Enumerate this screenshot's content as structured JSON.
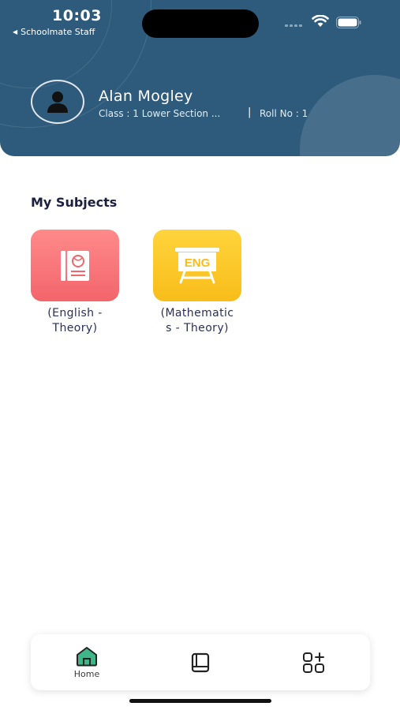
{
  "status_bar": {
    "time": "10:03",
    "back_app": "Schoolmate Staff"
  },
  "profile": {
    "name": "Alan Mogley",
    "class_info": "Class : 1 Lower Section ...",
    "separator": "|",
    "roll": "Roll No : 1"
  },
  "subjects": {
    "title": "My Subjects",
    "items": [
      {
        "line1": "(English -",
        "line2": "Theory)",
        "color": "#f2656b",
        "icon": "book-icon"
      },
      {
        "line1": "(Mathematic",
        "line2": "s - Theory)",
        "color": "#f8bd1a",
        "icon": "eng-board-icon",
        "icon_text": "ENG"
      }
    ]
  },
  "bottom_nav": {
    "items": [
      {
        "label": "Home",
        "icon": "home-icon",
        "active": true,
        "active_color": "#3fb58a"
      },
      {
        "label": "",
        "icon": "book-icon"
      },
      {
        "label": "",
        "icon": "apps-plus-icon"
      }
    ]
  },
  "colors": {
    "header": "#2e5b7c",
    "title_text": "#1d1f3f"
  }
}
